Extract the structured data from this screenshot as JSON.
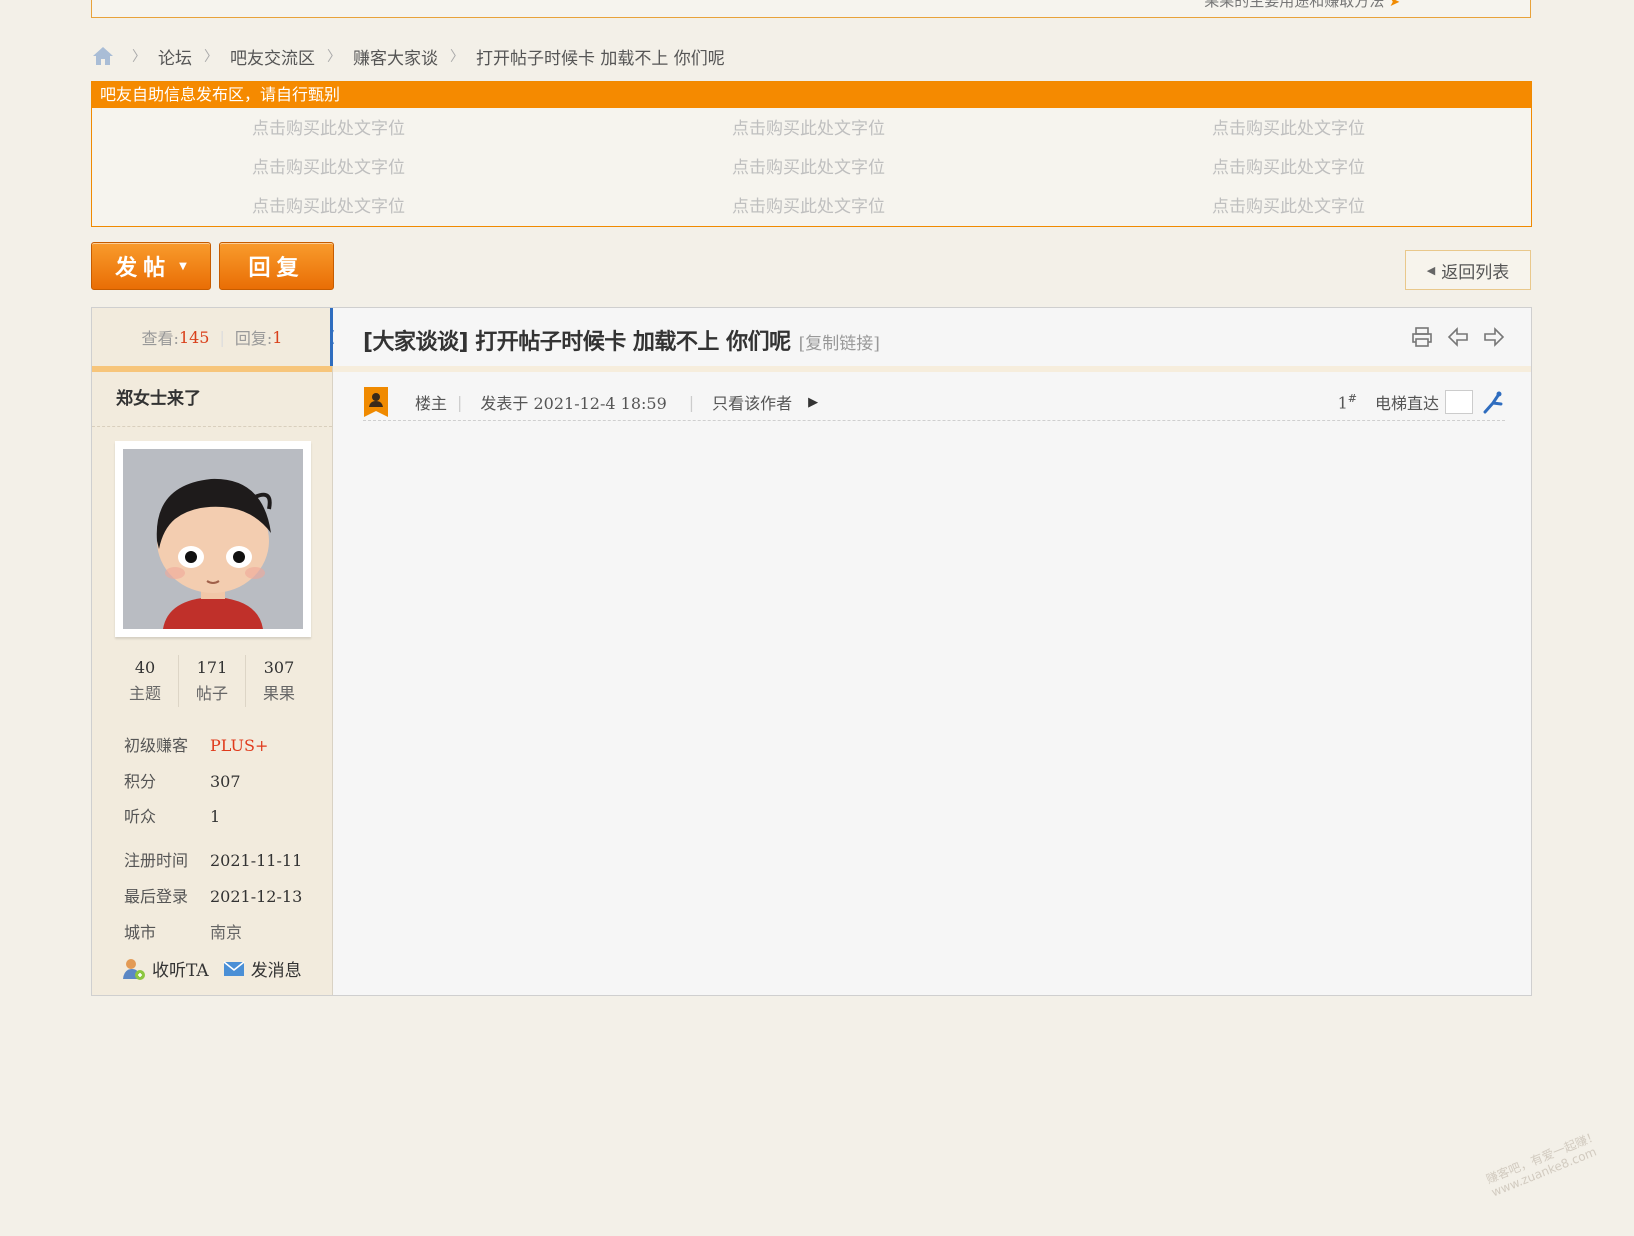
{
  "top_notice": {
    "text": "果果的主要用途和赚取方法"
  },
  "breadcrumb": {
    "items": [
      "论坛",
      "吧友交流区",
      "赚客大家谈",
      "打开帖子时候卡 加载不上 你们呢"
    ]
  },
  "ad_box": {
    "header": "吧友自助信息发布区，请自行甄别",
    "slots": [
      [
        "点击购买此处文字位",
        "点击购买此处文字位",
        "点击购买此处文字位"
      ],
      [
        "点击购买此处文字位",
        "点击购买此处文字位",
        "点击购买此处文字位"
      ],
      [
        "点击购买此处文字位",
        "点击购买此处文字位",
        "点击购买此处文字位"
      ]
    ]
  },
  "toolbar": {
    "post_label": "发帖",
    "reply_label": "回复",
    "back_label": "返回列表"
  },
  "thread": {
    "views_label": "查看:",
    "views": "145",
    "replies_label": "回复:",
    "replies": "1",
    "title": "[大家谈谈] 打开帖子时候卡 加载不上 你们呢",
    "copy_link": "[复制链接]"
  },
  "author": {
    "name": "郑女士来了",
    "counts": [
      {
        "value": "40",
        "label": "主题"
      },
      {
        "value": "171",
        "label": "帖子"
      },
      {
        "value": "307",
        "label": "果果"
      }
    ],
    "rank_label": "初级赚客",
    "rank_plus": "PLUS+",
    "points_label": "积分",
    "points": "307",
    "listeners_label": "听众",
    "listeners": "1",
    "reg_label": "注册时间",
    "reg_date": "2021-11-11",
    "last_label": "最后登录",
    "last_date": "2021-12-13",
    "city_label": "城市",
    "city": "南京",
    "follow_label": "收听TA",
    "message_label": "发消息"
  },
  "post_meta": {
    "role": "楼主",
    "posted": "发表于 2021-12-4 18:59",
    "only_author": "只看该作者",
    "floor": "1",
    "floor_sup": "#",
    "jump_label": "电梯直达"
  },
  "watermark": {
    "line1": "赚客吧，有爱一起赚！",
    "line2": "www.zuanke8.com"
  },
  "colors": {
    "accent": "#f58a00",
    "red": "#d9401b",
    "background": "#f3f0e8"
  }
}
